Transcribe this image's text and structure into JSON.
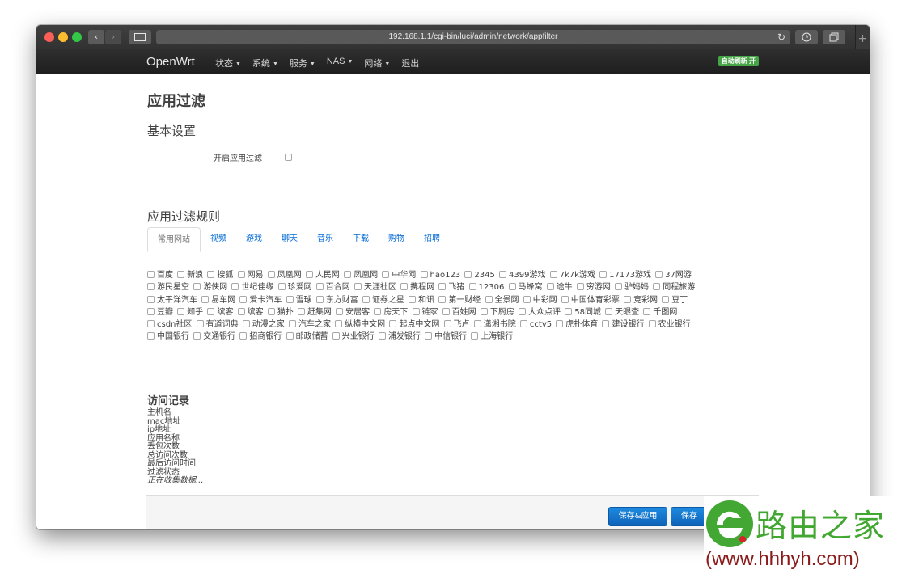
{
  "browser": {
    "url": "192.168.1.1/cgi-bin/luci/admin/network/appfilter",
    "back_icon": "‹",
    "forward_icon": "›",
    "reload_icon": "↻",
    "new_tab_icon": "+"
  },
  "navbar": {
    "brand": "OpenWrt",
    "menu": [
      "状态",
      "系统",
      "服务",
      "NAS",
      "网络",
      "退出"
    ],
    "autorefresh": "自动刷新 开",
    "accent": "#46a546"
  },
  "page": {
    "title": "应用过滤",
    "basic_settings": "基本设置",
    "enable_label": "开启应用过滤",
    "rules_title": "应用过滤规则",
    "tabs": [
      "常用网站",
      "视频",
      "游戏",
      "聊天",
      "音乐",
      "下载",
      "购物",
      "招聘"
    ],
    "apps": [
      "百度",
      "新浪",
      "搜狐",
      "网易",
      "凤凰网",
      "人民网",
      "凤凰网",
      "中华网",
      "hao123",
      "2345",
      "4399游戏",
      "7k7k游戏",
      "17173游戏",
      "37网游",
      "游民星空",
      "游侠网",
      "世纪佳缘",
      "珍爱网",
      "百合网",
      "天涯社区",
      "携程网",
      "飞猪",
      "12306",
      "马蜂窝",
      "途牛",
      "穷游网",
      "驴妈妈",
      "同程旅游",
      "太平洋汽车",
      "易车网",
      "爱卡汽车",
      "雪球",
      "东方财富",
      "证券之星",
      "和讯",
      "第一财经",
      "全景网",
      "中彩网",
      "中国体育彩票",
      "竞彩网",
      "豆丁",
      "豆瓣",
      "知乎",
      "缤客",
      "缤客",
      "猫扑",
      "赶集网",
      "安居客",
      "房天下",
      "链家",
      "百姓网",
      "下厨房",
      "大众点评",
      "58同城",
      "天眼查",
      "千图网",
      "csdn社区",
      "有道词典",
      "动漫之家",
      "汽车之家",
      "纵横中文网",
      "起点中文网",
      "飞卢",
      "潇湘书院",
      "cctv5",
      "虎扑体育",
      "建设银行",
      "农业银行",
      "中国银行",
      "交通银行",
      "招商银行",
      "邮政储蓄",
      "兴业银行",
      "浦发银行",
      "中信银行",
      "上海银行"
    ],
    "records_title": "访问记录",
    "records": [
      "主机名",
      "mac地址",
      "ip地址",
      "应用名称",
      "丢包次数",
      "总访问次数",
      "最后访问时间",
      "过滤状态"
    ],
    "collecting": "正在收集数据...",
    "save_apply": "保存&应用",
    "save": "保存"
  },
  "watermark": {
    "title": "路由之家",
    "url": "(www.hhhyh.com)"
  }
}
